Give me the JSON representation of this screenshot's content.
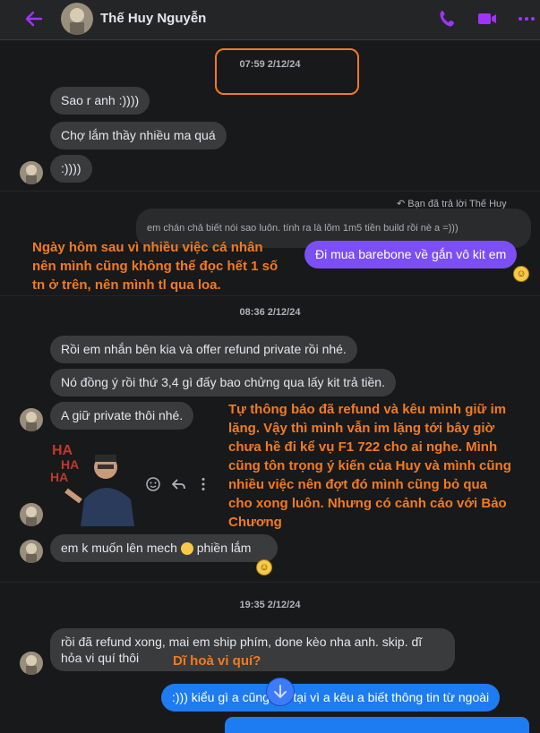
{
  "header": {
    "contact_name": "Thế Huy Nguyễn"
  },
  "messages": {
    "ts1": "07:59 2/12/24",
    "m1": "Sao r anh :))))",
    "m2": "Chợ lắm thầy nhiều ma quá",
    "m3": ":))))",
    "reply_note": "Bạn đã trả lời Thế Huy",
    "quoted": "em chán chả biết nói sao luôn. tính ra là lõm 1m5 tiền build rồi nè a =)))",
    "m4": "Đi mua barebone về gắn vô kit em",
    "ts2": "08:36 2/12/24",
    "m5": "Rồi em nhắn bên kia và offer refund private rồi nhé.",
    "m6": "Nó đồng ý rồi thứ 3,4 gì đấy bao chửng qua lấy kit trả tiền.",
    "m7": "A giữ private thôi nhé.",
    "m8a": "em k muốn lên mech",
    "m8b": "phiền lắm",
    "ts3": "19:35 2/12/24",
    "m9a": "rồi đã refund xong, mai em ship phím, done kèo nha anh. skip. dĩ",
    "m9b": "hỏa vi quí thôi",
    "m10": ":))) kiểu gì a cũng l   n, tại vì a kêu a biết thông tin từ ngoài"
  },
  "annotations": {
    "a1_line1": "Ngày hôm sau vì nhiều việc cá nhân",
    "a1_line2": "nên mình cũng không thể đọc hết 1 số",
    "a1_line3": "tn ở trên, nên mình tl qua loa.",
    "a2_line1": "Tự thông báo đã refund và kêu mình giữ im",
    "a2_line2": "lặng. Vậy thì mình vẫn im lặng tới bây giờ",
    "a2_line3": "chưa hề đi kể vụ F1 722 cho ai nghe. Mình",
    "a2_line4": "cũng tôn trọng ý kiến của Huy và mình cũng",
    "a2_line5": "nhiều việc nên đợt đó mình cũng bỏ qua",
    "a2_line6": "cho xong luôn. Nhưng có cảnh cáo với Bảo",
    "a2_line7": "Chương",
    "a3": "Dĩ hoà vi quí?"
  },
  "sticker_text": "HA HA HA",
  "colors": {
    "accent": "#a033ff",
    "annotation": "#f47a1f",
    "sent_purple": "#7b4ff5",
    "sent_blue": "#1e7cf2"
  }
}
